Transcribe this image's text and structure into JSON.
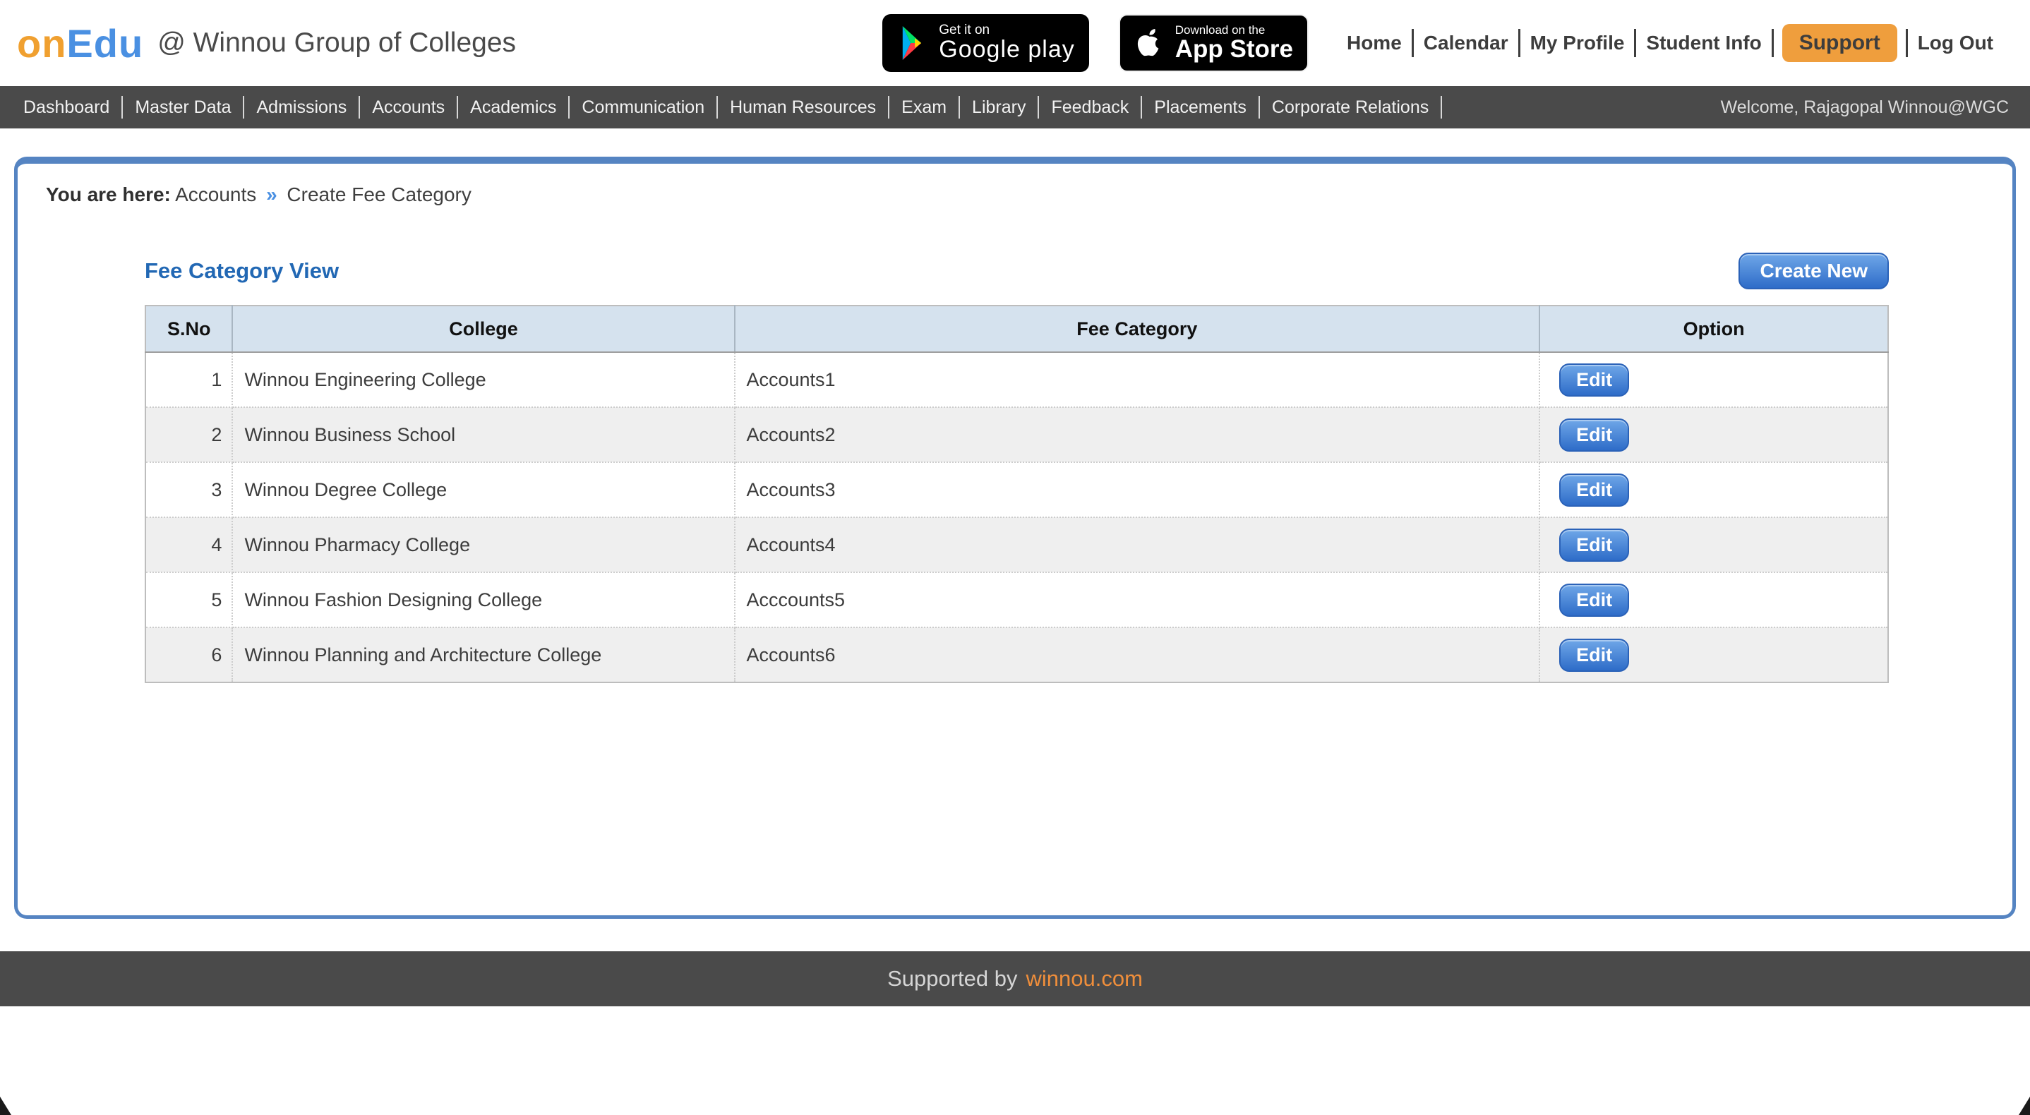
{
  "header": {
    "logo": {
      "prefix": "on",
      "suffix": "Edu"
    },
    "org_title": "@ Winnou Group of Colleges",
    "badges": {
      "google_play": {
        "line1": "Get it on",
        "line2": "Google play"
      },
      "app_store": {
        "line1": "Download on the",
        "line2": "App Store"
      }
    },
    "links": {
      "home": "Home",
      "calendar": "Calendar",
      "my_profile": "My Profile",
      "student_info": "Student Info",
      "support": "Support",
      "log_out": "Log Out"
    }
  },
  "nav": {
    "items": [
      "Dashboard",
      "Master Data",
      "Admissions",
      "Accounts",
      "Academics",
      "Communication",
      "Human Resources",
      "Exam",
      "Library",
      "Feedback",
      "Placements",
      "Corporate Relations"
    ],
    "welcome": "Welcome, Rajagopal Winnou@WGC"
  },
  "breadcrumb": {
    "prefix": "You are here:",
    "section": "Accounts",
    "separator": "»",
    "page": "Create Fee Category"
  },
  "main": {
    "heading": "Fee Category View",
    "create_button": "Create New"
  },
  "table": {
    "headers": [
      "S.No",
      "College",
      "Fee Category",
      "Option"
    ],
    "rows": [
      {
        "sno": "1",
        "college": "Winnou Engineering College",
        "fee_category": "Accounts1",
        "action": "Edit"
      },
      {
        "sno": "2",
        "college": "Winnou Business School",
        "fee_category": "Accounts2",
        "action": "Edit"
      },
      {
        "sno": "3",
        "college": "Winnou Degree College",
        "fee_category": "Accounts3",
        "action": "Edit"
      },
      {
        "sno": "4",
        "college": "Winnou Pharmacy College",
        "fee_category": "Accounts4",
        "action": "Edit"
      },
      {
        "sno": "5",
        "college": "Winnou Fashion Designing College",
        "fee_category": "Acccounts5",
        "action": "Edit"
      },
      {
        "sno": "6",
        "college": "Winnou Planning and Architecture College",
        "fee_category": "Accounts6",
        "action": "Edit"
      }
    ]
  },
  "footer": {
    "supported_by": "Supported by",
    "link": "winnou.com"
  },
  "colors": {
    "accent_orange": "#F0A030",
    "accent_blue": "#4A90E2",
    "nav_bg": "#4A4A4A",
    "panel_border": "#5584C2",
    "heading_blue": "#2268B4",
    "button_blue": "#2E6CC8",
    "support_orange": "#EF9E3D",
    "footer_link_orange": "#EF8E3B",
    "table_header_bg": "#D5E2EE"
  }
}
